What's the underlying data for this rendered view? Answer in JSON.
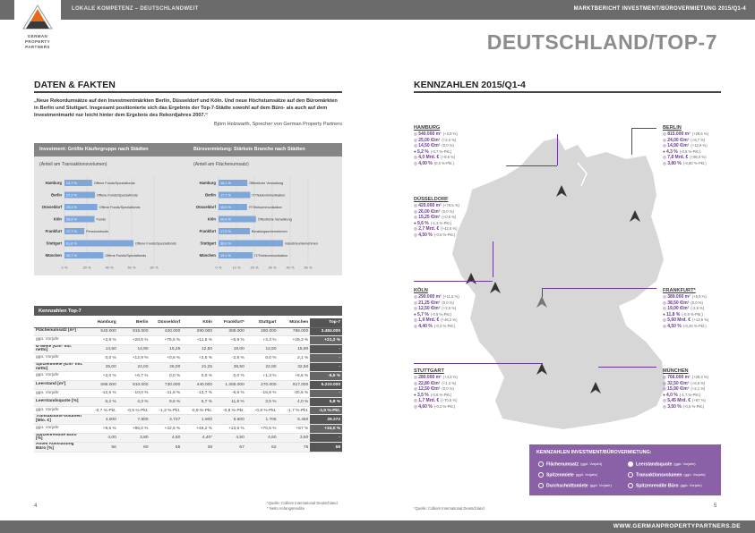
{
  "header": {
    "left": "LOKALE KOMPETENZ – DEUTSCHLANDWEIT",
    "right": "MARKTBERICHT INVESTMENT/BÜROVERMIETUNG 2015/Q1-4"
  },
  "logo": {
    "line1": "GERMAN",
    "line2": "PROPERTY",
    "line3": "PARTNERS"
  },
  "page_title": "DEUTSCHLAND/TOP-7",
  "left": {
    "section": "DATEN & FAKTEN",
    "quote": "„Neue Rekordumsätze auf den Investmentmärkten Berlin, Düsseldorf und Köln. Und neue Höchstumsätze auf den Büromärkten in Berlin und Stuttgart. Insgesamt positionierte sich das Ergebnis der Top-7-Städte sowohl auf dem Büro- als auch auf dem Investmentmarkt nur leicht hinter dem Ergebnis des Rekordjahres 2007.“",
    "author": "Björn Holzwarth, Sprecher von German Property Partners"
  },
  "chart_data": [
    {
      "type": "bar",
      "title": "Investment: Größte Käufergruppe nach Städten",
      "subtitle": "(Anteil am Transaktionsvolumen)",
      "categories": [
        "Hamburg",
        "Berlin",
        "Düsseldorf",
        "Köln",
        "Frankfurt",
        "Stuttgart",
        "München"
      ],
      "values": [
        24.7,
        27.2,
        29.3,
        26.8,
        17.7,
        61.6,
        34.7
      ],
      "value_labels": [
        "24,7 %",
        "27,2 %",
        "29,3 %",
        "26,8 %",
        "17,7 %",
        "61,6 %",
        "34,7 %"
      ],
      "bar_labels": [
        "Offene Fonds/Spezialfonds",
        "Offene Fonds/Spezialfonds",
        "Offene Fonds/Spezialfonds",
        "Fonds",
        "Pensionsfonds",
        "Offene Fonds/Spezialfonds",
        "Offene Fonds/Spezialfonds"
      ],
      "ticks": [
        "0 %",
        "20 %",
        "40 %",
        "60 %",
        "80 %"
      ],
      "xlim": [
        0,
        80
      ]
    },
    {
      "type": "bar",
      "title": "Bürovermietung: Stärkste Branche nach Städten",
      "subtitle": "(Anteil am Flächenumsatz)",
      "categories": [
        "Hamburg",
        "Berlin",
        "Düsseldorf",
        "Köln",
        "Frankfurt",
        "Stuttgart",
        "München"
      ],
      "values": [
        16.1,
        17.7,
        15.9,
        20.9,
        17.5,
        36.0,
        19.1
      ],
      "value_labels": [
        "16,1 %",
        "17,7 %",
        "15,9 %",
        "20,9 %",
        "17,5 %",
        "36,0 %",
        "19,1 %"
      ],
      "bar_labels": [
        "Öffentliche Verwaltung",
        "IT/Telekommunikation",
        "IT/Telekommunikation",
        "Öffentliche Verwaltung",
        "Beratungsunternehmen",
        "Industrieunternehmen",
        "IT/Telekommunikation"
      ],
      "ticks": [
        "0 %",
        "10 %",
        "20 %",
        "30 %",
        "40 %",
        "50 %"
      ],
      "xlim": [
        0,
        50
      ]
    }
  ],
  "table": {
    "title": "Kennzahlen Top-7",
    "headers": [
      "",
      "Hamburg",
      "Berlin",
      "Düsseldorf",
      "Köln",
      "Frankfurt*",
      "Stuttgart",
      "München",
      "Top-7"
    ],
    "rows": [
      {
        "cls": "main",
        "cells": [
          "Flächenumsatz [m²]",
          "540.000",
          "815.000",
          "420.000",
          "290.000",
          "389.000",
          "280.000",
          "766.000",
          "3.484.000"
        ]
      },
      {
        "cls": "sub",
        "cells": [
          "ggü. Vorjahr",
          "+2,9 %",
          "+28,6 %",
          "+76,5 %",
          "+11,5 %",
          "+5,9 %",
          "+4,3 %",
          "+29,3 %",
          "+21,2 %"
        ]
      },
      {
        "cls": "main",
        "cells": [
          "Ø Miete [€/m² mtl. netto]",
          "14,50",
          "14,90",
          "15,25",
          "12,50",
          "19,00",
          "12,50",
          "15,90",
          "-"
        ]
      },
      {
        "cls": "sub",
        "cells": [
          "ggü. Vorjahr",
          "0,0 %",
          "+12,9 %",
          "+0,6 %",
          "+2,5 %",
          "-2,8 %",
          "0,0 %",
          "2,1 %",
          "-"
        ]
      },
      {
        "cls": "main",
        "cells": [
          "Spitzenmiete [€/m² mtl. netto]",
          "25,00",
          "24,00",
          "26,00",
          "21,25",
          "38,50",
          "22,80",
          "32,50",
          "-"
        ]
      },
      {
        "cls": "sub",
        "cells": [
          "ggü. Vorjahr",
          "+2,0 %",
          "+6,7 %",
          "0,0 %",
          "0,0 %",
          "0,0 %",
          "+1,3 %",
          "+6,6 %",
          "-5,5 %"
        ]
      },
      {
        "cls": "main",
        "cells": [
          "Leerstand [m²]",
          "698.000",
          "810.000",
          "730.000",
          "440.000",
          "1.358.000",
          "270.000",
          "917.000",
          "5.223.000"
        ]
      },
      {
        "cls": "sub",
        "cells": [
          "ggü. Vorjahr",
          "-12,6 %",
          "-10,0 %",
          "-11,8 %",
          "-13,7 %",
          "-6,6 %",
          "-16,9 %",
          "-30,6 %",
          "-"
        ]
      },
      {
        "cls": "main",
        "cells": [
          "Leerstandsquote [%]",
          "5,2 %",
          "4,3 %",
          "9,6 %",
          "5,7 %",
          "11,8 %",
          "3,5 %",
          "4,0 %",
          "5,8 %"
        ]
      },
      {
        "cls": "sub",
        "cells": [
          "ggü. Vorjahr",
          "-0,7 %-Pkt.",
          "-0,5 %-Pkt.",
          "-1,3 %-Pkt.",
          "-0,9 %-Pkt.",
          "-0,8 %-Pkt.",
          "-0,8 %-Pkt.",
          "-1,7 %-Pkt.",
          "-1,0 %-Pkt."
        ]
      },
      {
        "cls": "main",
        "cells": [
          "Transaktions-volumen [Mio. €]",
          "4.000",
          "7.800",
          "2.727",
          "1.900",
          "5.600",
          "1.705",
          "5.450",
          "29.272"
        ]
      },
      {
        "cls": "sub",
        "cells": [
          "ggü. Vorjahr",
          "+9,6 %",
          "+96,0 %",
          "+42,6 %",
          "+46,2 %",
          "+13,6 %",
          "+70,5 %",
          "+67 %",
          "+34,0 %"
        ]
      },
      {
        "cls": "main",
        "cells": [
          "Spitzenrendite Büro [%]",
          "4,00",
          "3,80",
          "4,50",
          "4,40*",
          "4,50",
          "4,60",
          "3,50",
          "-"
        ]
      },
      {
        "cls": "main",
        "cells": [
          "Anteil Ausstattung Büro [%]",
          "56",
          "60",
          "55",
          "38",
          "67",
          "62",
          "75",
          "58"
        ]
      }
    ]
  },
  "notes": [
    "*Quelle: Colliers International Deutschland",
    "* Netto Anfangsrendite"
  ],
  "page_left": "4",
  "page_right": "5",
  "right": {
    "section": "KENNZAHLEN 2015/Q1-4"
  },
  "cities": [
    {
      "name": "HAMBURG",
      "rows": [
        [
          "540.000 m²",
          "(+2,9 %)"
        ],
        [
          "25,00 €/m²",
          "(+2,0 %)"
        ],
        [
          "14,50 €/m²",
          "(0,0 %)"
        ],
        [
          "5,2 %",
          "(-0,7 %-Pkt.)"
        ],
        [
          "4,0 Mrd. €",
          "(+9,6 %)"
        ],
        [
          "4,00 %",
          "(0,0 %-Pkt.)"
        ]
      ]
    },
    {
      "name": "BERLIN",
      "rows": [
        [
          "815.000 m²",
          "(+28,6 %)"
        ],
        [
          "24,00 €/m²",
          "(+6,7 %)"
        ],
        [
          "14,90 €/m²",
          "(+12,9 %)"
        ],
        [
          "4,3 %",
          "(-0,5 %-Pkt.)"
        ],
        [
          "7,8 Mrd. €",
          "(+96,0 %)"
        ],
        [
          "3,80 %",
          "(-0,80 %-Pkt.)"
        ]
      ]
    },
    {
      "name": "DÜSSELDORF",
      "rows": [
        [
          "420.000 m²",
          "(+76,5 %)"
        ],
        [
          "26,00 €/m²",
          "(0,0 %)"
        ],
        [
          "15,25 €/m²",
          "(+0,6 %)"
        ],
        [
          "9,6 %",
          "(-1,3 %-Pkt.)"
        ],
        [
          "2,7 Mrd. €",
          "(+42,6 %)"
        ],
        [
          "4,50 %",
          "(-0,5 %-Pkt.)"
        ]
      ]
    },
    {
      "name": "KÖLN",
      "rows": [
        [
          "290.000 m²",
          "(+11,5 %)"
        ],
        [
          "21,25 €/m²",
          "(0,0 %)"
        ],
        [
          "12,50 €/m²",
          "(+2,5 %)"
        ],
        [
          "5,7 %",
          "(-0,9 %-Pkt.)"
        ],
        [
          "1,9 Mrd. €",
          "(+46,2 %)"
        ],
        [
          "4,40 %",
          "(-0,3 %-Pkt.)"
        ]
      ]
    },
    {
      "name": "FRANKFURT*",
      "rows": [
        [
          "389.000 m²",
          "(+5,9 %)"
        ],
        [
          "38,50 €/m²",
          "(0,0 %)"
        ],
        [
          "19,00 €/m²",
          "(-2,8 %)"
        ],
        [
          "11,8 %",
          "(-0,8 %-Pkt.)"
        ],
        [
          "5,60 Mrd. €",
          "(+13,6 %)"
        ],
        [
          "4,50 %",
          "(-0,25 %-Pkt.)"
        ]
      ]
    },
    {
      "name": "STUTTGART",
      "rows": [
        [
          "280.000 m²",
          "(+4,3 %)"
        ],
        [
          "22,80 €/m²",
          "(+1,3 %)"
        ],
        [
          "12,50 €/m²",
          "(0,0 %)"
        ],
        [
          "3,5 %",
          "(-0,8 %-Pkt.)"
        ],
        [
          "1,7 Mrd. €",
          "(+70,5 %)"
        ],
        [
          "4,60 %",
          "(-0,3 %-Pkt.)"
        ]
      ]
    },
    {
      "name": "MÜNCHEN",
      "rows": [
        [
          "766.000 m²",
          "(+29,3 %)"
        ],
        [
          "32,50 €/m²",
          "(+6,6 %)"
        ],
        [
          "15,90 €/m²",
          "(+2,1 %)"
        ],
        [
          "4,0 %",
          "(-1,7 %-Pkt.)"
        ],
        [
          "5,45 Mrd. €",
          "(+67 %)"
        ],
        [
          "3,50 %",
          "(-0,5 %-Pkt.)"
        ]
      ]
    }
  ],
  "legend": {
    "title": "KENNZAHLEN INVESTMENT/BÜROVERMIETUNG:",
    "items": [
      {
        "label": "Flächenumsatz",
        "sub": "(ggü. Vorjahr)",
        "filled": false
      },
      {
        "label": "Leerstandsquote",
        "sub": "(ggü. Vorjahr)",
        "filled": true
      },
      {
        "label": "Spitzenmiete",
        "sub": "(ggü. Vorjahr)",
        "filled": false
      },
      {
        "label": "Transaktionsvolumen",
        "sub": "(ggü. Vorjahr)",
        "filled": false
      },
      {
        "label": "Durchschnittsmiete",
        "sub": "(ggü. Vorjahr)",
        "filled": false
      },
      {
        "label": "Spitzenrendite Büro",
        "sub": "(ggü. Vorjahr)",
        "filled": false
      }
    ]
  },
  "source_right": "*Quelle: Colliers International Deutschland",
  "footer_url": "WWW.GERMANPROPERTYPARTNERS.DE"
}
